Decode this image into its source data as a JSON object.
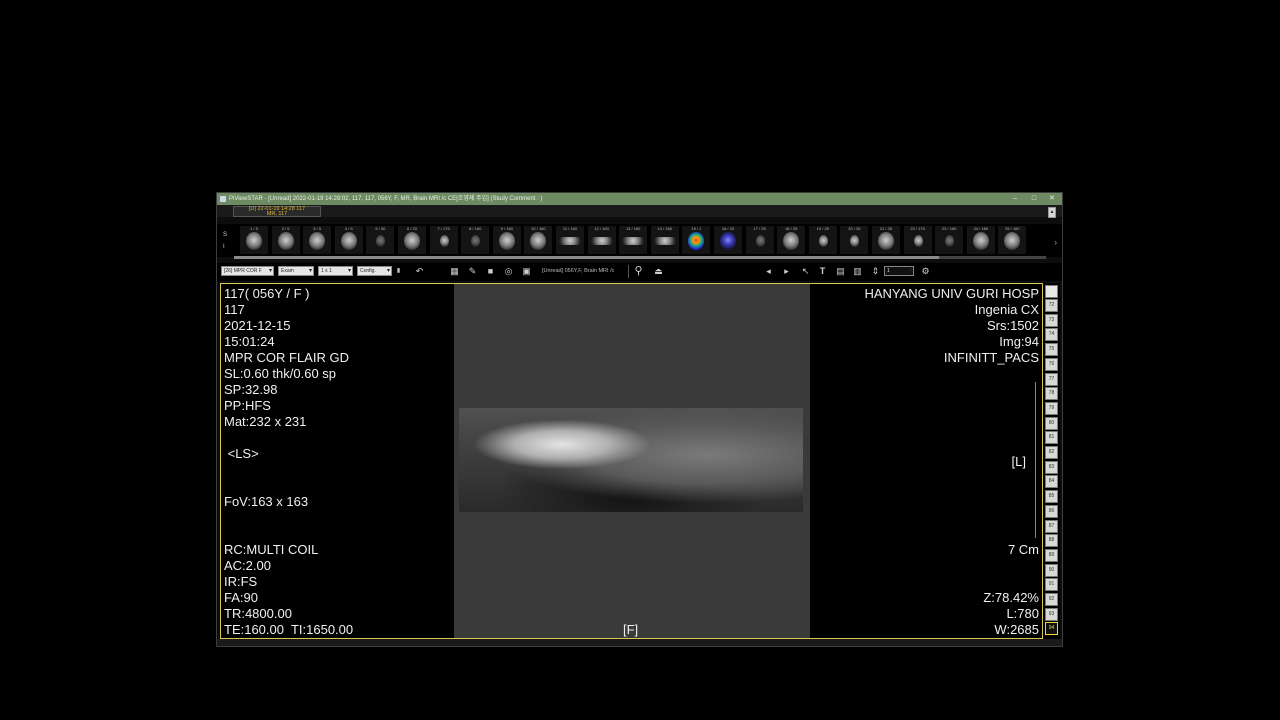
{
  "window": {
    "title": "PiViewSTAR - [Unread] 2022-01-19 14:28:02, 117, 117, 056Y, F, MR, Brain MRI /c CE[조영제 주입]  (Study Comment : )",
    "buttons": [
      "–",
      "□",
      "✕"
    ]
  },
  "tab": {
    "line1": "[U] 22-01-19 14:28  117",
    "line2": "MR, 117"
  },
  "thumbnails": {
    "side_label": "S",
    "items": [
      {
        "label": "1 / 5",
        "kind": "head"
      },
      {
        "label": "2 / 5",
        "kind": "head"
      },
      {
        "label": "3 / 5",
        "kind": "head"
      },
      {
        "label": "4 / 5",
        "kind": "head"
      },
      {
        "label": "5 / 30",
        "kind": "dark"
      },
      {
        "label": "6 / 20",
        "kind": "head"
      },
      {
        "label": "7 / 175",
        "kind": "small"
      },
      {
        "label": "8 / 160",
        "kind": "dark"
      },
      {
        "label": "9 / 160",
        "kind": "head"
      },
      {
        "label": "10 / 160",
        "kind": "head"
      },
      {
        "label": "11 / 160",
        "kind": "wide"
      },
      {
        "label": "12 / 160",
        "kind": "wide"
      },
      {
        "label": "13 / 160",
        "kind": "wide"
      },
      {
        "label": "14 / 160",
        "kind": "wide"
      },
      {
        "label": "15 / 1",
        "kind": "color"
      },
      {
        "label": "16 / 25",
        "kind": "blue"
      },
      {
        "label": "17 / 25",
        "kind": "dark"
      },
      {
        "label": "18 / 25",
        "kind": "head"
      },
      {
        "label": "19 / 25",
        "kind": "small"
      },
      {
        "label": "20 / 26",
        "kind": "small"
      },
      {
        "label": "21 / 26",
        "kind": "head"
      },
      {
        "label": "22 / 175",
        "kind": "small"
      },
      {
        "label": "23 / 160",
        "kind": "dark"
      },
      {
        "label": "24 / 160",
        "kind": "head"
      },
      {
        "label": "25 / 160",
        "kind": "head"
      }
    ],
    "next_arrow": "›"
  },
  "toolbar": {
    "series_select": "[26] MPR COR F",
    "exam_select": "Exam",
    "layout_select": "1 x 1",
    "config_select": "Config.",
    "study_text": "[Unread] 056Y,F, Brain MRI /c",
    "frame_select": "1"
  },
  "overlay_left": {
    "patient": "117( 056Y / F )",
    "id": "117",
    "date": "2021-12-15",
    "time": "15:01:24",
    "series": "MPR COR FLAIR GD",
    "sl": "SL:0.60 thk/0.60 sp",
    "sp": "SP:32.98",
    "pp": "PP:HFS",
    "mat": "Mat:232 x 231",
    "orient": " <LS>",
    "fov": "FoV:163 x 163",
    "rc": "RC:MULTI COIL",
    "ac": "AC:2.00",
    "ir": "IR:FS",
    "fa": "FA:90",
    "tr": "TR:4800.00",
    "te": "TE:160.00  TI:1650.00"
  },
  "overlay_right": {
    "hospital": "HANYANG UNIV GURI HOSP",
    "scanner": "Ingenia CX",
    "srs": "Srs:1502",
    "img": "Img:94",
    "pacs": "INFINITT_PACS",
    "side": "[L]",
    "scale": "7 Cm",
    "zoom": "Z:78.42%",
    "level": "L:780",
    "width": "W:2685"
  },
  "overlay_bottom": {
    "orient": "[F]"
  },
  "slices": {
    "numbers": [
      "72",
      "73",
      "74",
      "75",
      "76",
      "77",
      "78",
      "79",
      "80",
      "81",
      "82",
      "83",
      "84",
      "85",
      "86",
      "87",
      "88",
      "89",
      "90",
      "91",
      "92",
      "93",
      "94"
    ],
    "active": "94"
  }
}
